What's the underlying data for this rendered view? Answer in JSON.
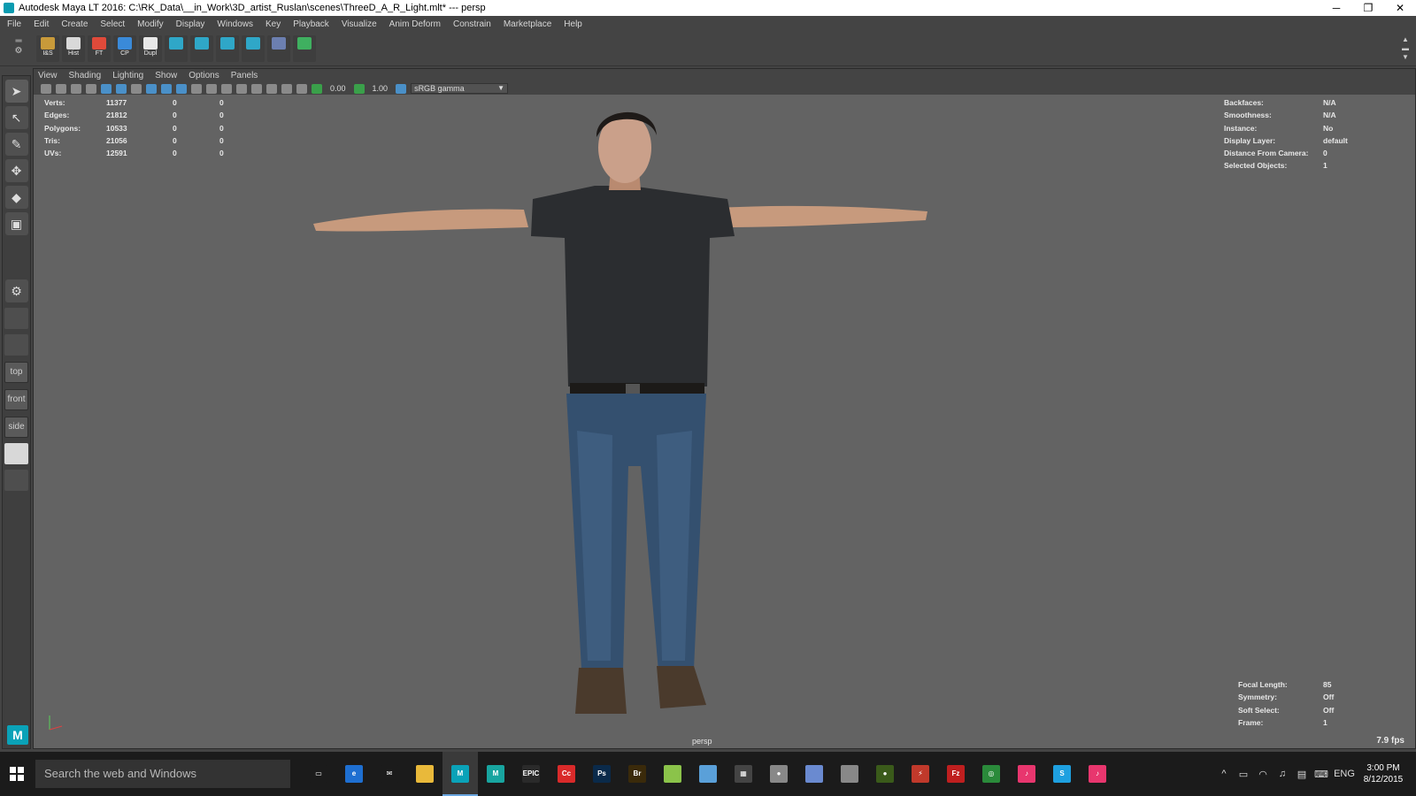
{
  "window": {
    "title": "Autodesk Maya LT 2016: C:\\RK_Data\\__in_Work\\3D_artist_Ruslan\\scenes\\ThreeD_A_R_Light.mlt*   ---   persp",
    "min": "─",
    "restore": "❐",
    "close": "✕"
  },
  "menu": [
    "File",
    "Edit",
    "Create",
    "Select",
    "Modify",
    "Display",
    "Windows",
    "Key",
    "Playback",
    "Visualize",
    "Anim Deform",
    "Constrain",
    "Marketplace",
    "Help"
  ],
  "shelf": [
    {
      "label": "I&S",
      "color": "#c89a3a"
    },
    {
      "label": "Hist",
      "color": "#d9d9d9"
    },
    {
      "label": "FT",
      "color": "#e04a3a"
    },
    {
      "label": "CP",
      "color": "#3a8ad9"
    },
    {
      "label": "Dupl",
      "color": "#e8e8e8"
    },
    {
      "label": "",
      "color": "#2fa7c8"
    },
    {
      "label": "",
      "color": "#2fa7c8"
    },
    {
      "label": "",
      "color": "#2fa7c8"
    },
    {
      "label": "",
      "color": "#2fa7c8"
    },
    {
      "label": "",
      "color": "#6c7fb0"
    },
    {
      "label": "",
      "color": "#3fb060"
    }
  ],
  "panel_menu": [
    "View",
    "Shading",
    "Lighting",
    "Show",
    "Options",
    "Panels"
  ],
  "panel_toolbar": {
    "field1": "0.00",
    "field2": "1.00",
    "color_space": "sRGB gamma"
  },
  "toolbox": {
    "views": [
      "top",
      "front",
      "side"
    ]
  },
  "hud_left": [
    [
      "Verts:",
      "11377",
      "0",
      "0"
    ],
    [
      "Edges:",
      "21812",
      "0",
      "0"
    ],
    [
      "Polygons:",
      "10533",
      "0",
      "0"
    ],
    [
      "Tris:",
      "21056",
      "0",
      "0"
    ],
    [
      "UVs:",
      "12591",
      "0",
      "0"
    ]
  ],
  "hud_right": [
    [
      "Backfaces:",
      "N/A"
    ],
    [
      "Smoothness:",
      "N/A"
    ],
    [
      "Instance:",
      "No"
    ],
    [
      "Display Layer:",
      "default"
    ],
    [
      "Distance From Camera:",
      "0"
    ],
    [
      "Selected Objects:",
      "1"
    ]
  ],
  "hud_bottom_right": [
    [
      "Focal Length:",
      "85"
    ],
    [
      "Symmetry:",
      "Off"
    ],
    [
      "Soft Select:",
      "Off"
    ],
    [
      "Frame:",
      "1"
    ]
  ],
  "camera_label": "persp",
  "fps": "7.9 fps",
  "taskbar": {
    "search_placeholder": "Search the web and Windows",
    "apps": [
      {
        "name": "task-view",
        "color": "#1b1b1b",
        "glyph": "▭"
      },
      {
        "name": "edge",
        "color": "#1e6fd1",
        "glyph": "e"
      },
      {
        "name": "mail",
        "color": "#1b1b1b",
        "glyph": "✉"
      },
      {
        "name": "explorer",
        "color": "#e9b93a",
        "glyph": ""
      },
      {
        "name": "maya-lt",
        "color": "#0aa2b8",
        "glyph": "M"
      },
      {
        "name": "maya",
        "color": "#18a5a0",
        "glyph": "M"
      },
      {
        "name": "epic",
        "color": "#2a2a2a",
        "glyph": "EPIC"
      },
      {
        "name": "creative-cloud",
        "color": "#d92a2a",
        "glyph": "Cc"
      },
      {
        "name": "photoshop",
        "color": "#0a2a4a",
        "glyph": "Ps"
      },
      {
        "name": "bridge",
        "color": "#3a2a0a",
        "glyph": "Br"
      },
      {
        "name": "notes",
        "color": "#8bc34a",
        "glyph": ""
      },
      {
        "name": "app",
        "color": "#5aa0d9",
        "glyph": ""
      },
      {
        "name": "calculator",
        "color": "#444",
        "glyph": "▦"
      },
      {
        "name": "app2",
        "color": "#888",
        "glyph": "●"
      },
      {
        "name": "app3",
        "color": "#6a8ad0",
        "glyph": ""
      },
      {
        "name": "app4",
        "color": "#888",
        "glyph": ""
      },
      {
        "name": "nvidia",
        "color": "#3a5a1a",
        "glyph": "●"
      },
      {
        "name": "app5",
        "color": "#c0392b",
        "glyph": "⚡"
      },
      {
        "name": "filezilla",
        "color": "#bf1f1f",
        "glyph": "Fz"
      },
      {
        "name": "app6",
        "color": "#2a8a3a",
        "glyph": "◎"
      },
      {
        "name": "itunes",
        "color": "#e8366e",
        "glyph": "♪"
      },
      {
        "name": "skype",
        "color": "#1ea0e0",
        "glyph": "S"
      },
      {
        "name": "itunes2",
        "color": "#e8366e",
        "glyph": "♪"
      }
    ],
    "tray_lang": "ENG",
    "time": "3:00 PM",
    "date": "8/12/2015"
  }
}
